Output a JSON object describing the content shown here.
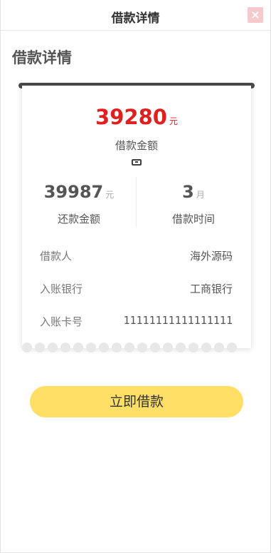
{
  "nav": {
    "title": "借款详情",
    "close_icon": "close-icon",
    "close_glyph": "×"
  },
  "heading": "借款详情",
  "loan": {
    "amount": "39280",
    "amount_unit": "元",
    "amount_label": "借款金额",
    "icon": "ticket-icon"
  },
  "stats": {
    "repay_amount": "39987",
    "repay_unit": "元",
    "repay_label": "还款金额",
    "term": "3",
    "term_unit": "月",
    "term_label": "借款时间"
  },
  "details": [
    {
      "key": "借款人",
      "value": "海外源码"
    },
    {
      "key": "入账银行",
      "value": "工商银行"
    },
    {
      "key": "入账卡号",
      "value": "11111111111111111"
    }
  ],
  "cta_label": "立即借款",
  "colors": {
    "accent_red": "#e02020",
    "button_yellow": "#ffdf66",
    "close_bg": "#f8c9cc"
  }
}
